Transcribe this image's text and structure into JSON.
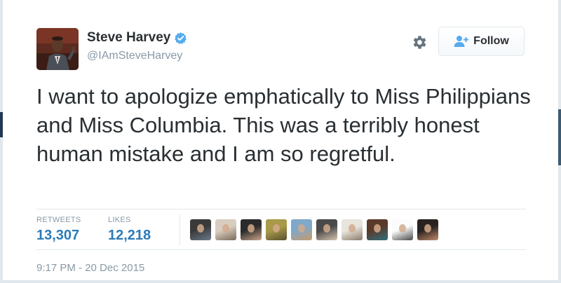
{
  "tweet": {
    "author_name": "Steve Harvey",
    "handle": "@IAmSteveHarvey",
    "verified": true,
    "text": "I want to apologize emphatically to Miss Philippians and Miss Columbia. This was a terribly honest human mistake and I am so regretful.",
    "timestamp": "9:17 PM - 20 Dec 2015"
  },
  "actions": {
    "follow_label": "Follow",
    "settings_icon": "gear-icon",
    "follow_icon": "add-user-icon"
  },
  "stats": {
    "retweets_label": "RETWEETS",
    "retweets_value": "13,307",
    "likes_label": "LIKES",
    "likes_value": "12,218"
  },
  "likers": [
    {
      "colors": [
        "#3a3a3a",
        "#6b7a8a"
      ]
    },
    {
      "colors": [
        "#d9cdbf",
        "#7a6a5a"
      ]
    },
    {
      "colors": [
        "#2b2b2b",
        "#c9a48a"
      ]
    },
    {
      "colors": [
        "#a89a48",
        "#5a5030"
      ]
    },
    {
      "colors": [
        "#7fa8c9",
        "#c99a6a"
      ]
    },
    {
      "colors": [
        "#4a4a4a",
        "#d8c4b0"
      ]
    },
    {
      "colors": [
        "#e8e4dc",
        "#8a7a6a"
      ]
    },
    {
      "colors": [
        "#5a3a2a",
        "#2f6f7f"
      ]
    },
    {
      "colors": [
        "#fbfbfb",
        "#4a4a4a"
      ]
    },
    {
      "colors": [
        "#2a2220",
        "#c08a6a"
      ]
    }
  ],
  "colors": {
    "link_blue": "#2b7bb9",
    "text_dark": "#292f33",
    "text_muted": "#8899a6",
    "verified_blue": "#55acee",
    "border": "#e1e8ed"
  }
}
